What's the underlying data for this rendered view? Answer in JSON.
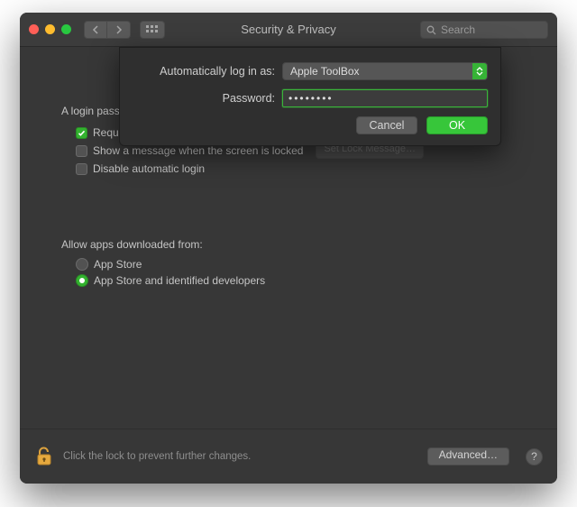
{
  "window": {
    "title": "Security & Privacy",
    "search_placeholder": "Search"
  },
  "dialog": {
    "autologin_label": "Automatically log in as:",
    "autologin_user": "Apple ToolBox",
    "password_label": "Password:",
    "password_value": "••••••••",
    "cancel": "Cancel",
    "ok": "OK"
  },
  "main": {
    "login_password_line": "A login password has been set for this user",
    "require_password_line": "Require password after sleep or screen saver begins",
    "show_message_line": "Show a message when the screen is locked",
    "set_lock_message_btn": "Set Lock Message…",
    "disable_auto_login": "Disable automatic login",
    "allow_downloads_label": "Allow apps downloaded from:",
    "radio_appstore": "App Store",
    "radio_appstore_dev": "App Store and identified developers"
  },
  "footer": {
    "lock_text": "Click the lock to prevent further changes.",
    "advanced": "Advanced…",
    "help": "?"
  }
}
